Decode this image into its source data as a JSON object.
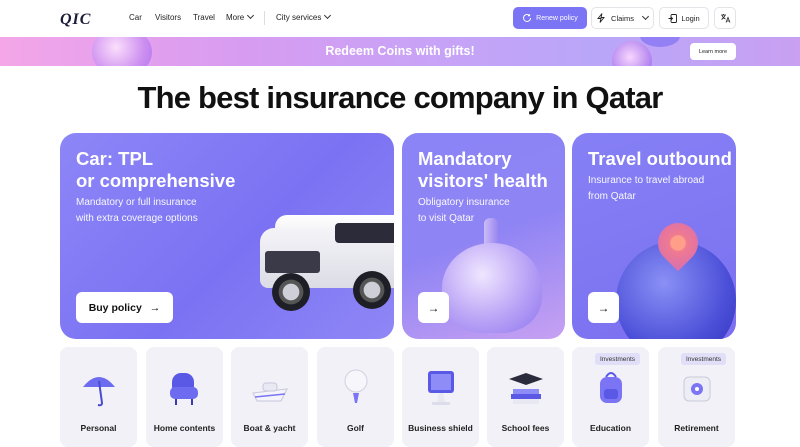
{
  "header": {
    "logo": "QIC",
    "nav": {
      "car": "Car",
      "visitors": "Visitors",
      "travel": "Travel",
      "more": "More"
    },
    "city_services": "City services",
    "renew_label": "Renew policy",
    "claims_label": "Claims",
    "login_label": "Login"
  },
  "banner": {
    "text": "Redeem Coins with gifts!",
    "button": "Learn more"
  },
  "headline": "The best insurance company in Qatar",
  "cards": [
    {
      "title_line1": "Car: TPL",
      "title_line2": "or comprehensive",
      "sub_line1": "Mandatory or full insurance",
      "sub_line2": "with extra coverage options",
      "button": "Buy policy"
    },
    {
      "title_line1": "Mandatory",
      "title_line2": "visitors' health",
      "sub_line1": "Obligatory insurance",
      "sub_line2": "to visit Qatar"
    },
    {
      "title_line1": "Travel outbound",
      "sub_line1": "Insurance to travel abroad",
      "sub_line2": "from Qatar"
    }
  ],
  "tiles": [
    {
      "label": "Personal",
      "icon": "umbrella-icon"
    },
    {
      "label": "Home contents",
      "icon": "armchair-icon"
    },
    {
      "label": "Boat & yacht",
      "icon": "boat-icon"
    },
    {
      "label": "Golf",
      "icon": "golf-icon"
    },
    {
      "label": "Business shield",
      "icon": "pos-terminal-icon"
    },
    {
      "label": "School fees",
      "icon": "graduation-cap-icon"
    },
    {
      "label": "Education",
      "icon": "backpack-icon",
      "badge": "Investments"
    },
    {
      "label": "Retirement",
      "icon": "safe-icon",
      "badge": "Investments"
    }
  ],
  "colors": {
    "accent": "#7b74f5",
    "tile_bg": "#f1f1f7"
  }
}
